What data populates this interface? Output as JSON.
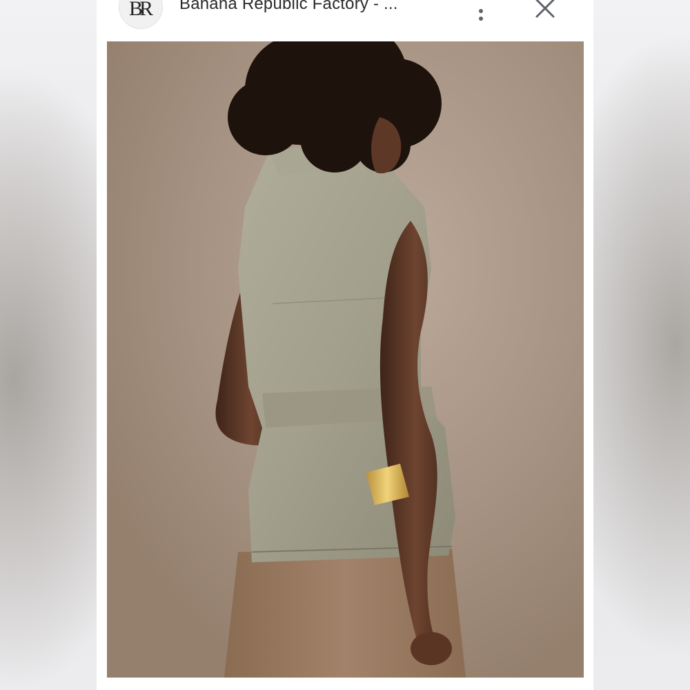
{
  "header": {
    "avatar_label": "BR",
    "source_title": "Banana Republic Factory - ...",
    "more_icon": "more-vert-icon",
    "close_icon": "close-icon"
  },
  "image": {
    "subject": "product-photo"
  },
  "colors": {
    "card": "#ffffff",
    "icon": "#5f6368",
    "title_text": "#2a2a2a"
  }
}
